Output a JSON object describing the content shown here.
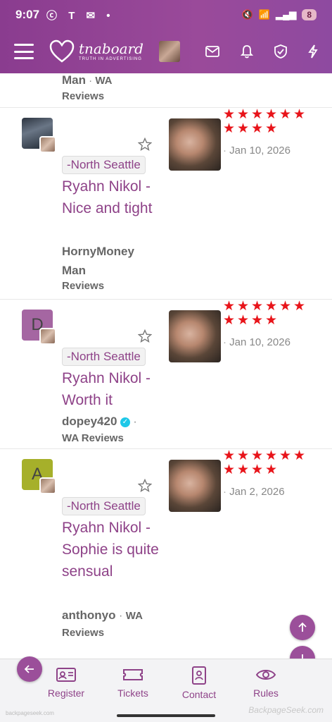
{
  "status": {
    "time": "9:07",
    "icons": [
      "c",
      "T",
      "M",
      "•"
    ],
    "battery": "8"
  },
  "header": {
    "logo_name": "tnaboard",
    "logo_tag": "TRUTH IN ADVERTISING"
  },
  "top_fragment": {
    "author_tail": "Man",
    "sep": " · ",
    "forum": "WA",
    "forum2": "Reviews"
  },
  "entries": [
    {
      "avatar_letter": "",
      "location": "-North Seattle",
      "title": "Ryahn Nikol - Nice and tight",
      "author": "HornyMoney Man",
      "forum_a": "WA",
      "forum_b": "Reviews",
      "date": "Jan 10, 2026",
      "rating": 10
    },
    {
      "avatar_letter": "D",
      "location": "-North Seattle",
      "title": "Ryahn Nikol - Worth it",
      "author": "dopey420",
      "forum_a": "",
      "forum_b": "WA Reviews",
      "date": "Jan 10, 2026",
      "rating": 10
    },
    {
      "avatar_letter": "A",
      "location": "-North Seattle",
      "title": "Ryahn Nikol - Sophie is quite sensual",
      "author": "anthonyo",
      "forum_a": "WA",
      "forum_b": "Reviews",
      "date": "Jan 2, 2026",
      "rating": 10
    }
  ],
  "nav": {
    "register": "Register",
    "tickets": "Tickets",
    "contact": "Contact",
    "rules": "Rules"
  },
  "watermark": "BackpageSeek.com",
  "watermark_left": "backpageseek.com",
  "colors": {
    "brand": "#8e4288",
    "star": "#e8141a",
    "verified": "#1ec8e8"
  }
}
